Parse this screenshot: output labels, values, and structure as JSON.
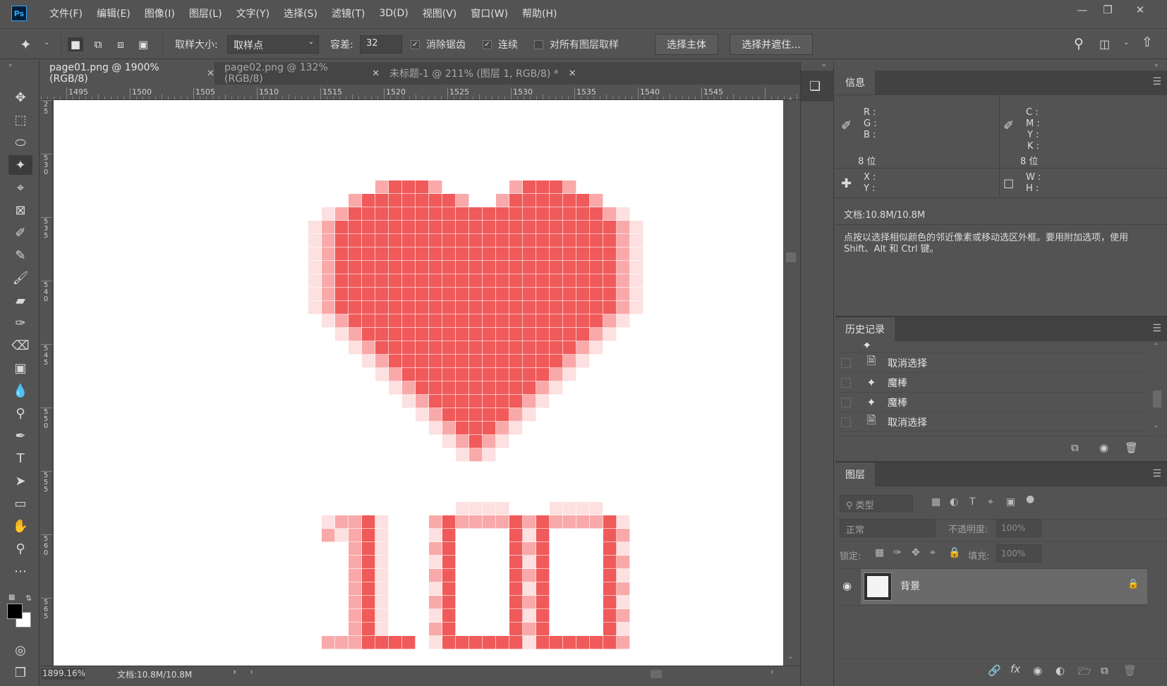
{
  "app": {
    "logo": "Ps"
  },
  "menu": [
    "文件(F)",
    "编辑(E)",
    "图像(I)",
    "图层(L)",
    "文字(Y)",
    "选择(S)",
    "滤镜(T)",
    "3D(D)",
    "视图(V)",
    "窗口(W)",
    "帮助(H)"
  ],
  "options": {
    "sample_size_label": "取样大小:",
    "sample_size_value": "取样点",
    "tolerance_label": "容差:",
    "tolerance_value": "32",
    "anti_alias_label": "消除锯齿",
    "anti_alias_checked": true,
    "contiguous_label": "连续",
    "contiguous_checked": true,
    "sample_all_label": "对所有图层取样",
    "sample_all_checked": false,
    "select_subject_label": "选择主体",
    "select_mask_label": "选择并遮住..."
  },
  "tabs": [
    {
      "label": "page01.png @ 1900%(RGB/8)",
      "active": true
    },
    {
      "label": "page02.png @ 132%(RGB/8)",
      "active": false
    },
    {
      "label": "未标题-1 @ 211% (图层 1, RGB/8) *",
      "active": false
    }
  ],
  "ruler": {
    "top_labels": [
      "1495",
      "1500",
      "1505",
      "1510",
      "1515",
      "1520",
      "1525",
      "1530",
      "1535",
      "1540",
      "1545"
    ],
    "left_labels": [
      "25",
      "530",
      "535",
      "540",
      "545",
      "550",
      "555",
      "560",
      "565"
    ]
  },
  "status": {
    "zoom": "1899.16%",
    "doc": "文档:10.8M/10.8M"
  },
  "info_panel": {
    "title": "信息",
    "rgb_labels": [
      "R :",
      "G :",
      "B :"
    ],
    "cmyk_labels": [
      "C :",
      "M :",
      "Y :",
      "K :"
    ],
    "bits_left": "8 位",
    "bits_right": "8 位",
    "xy_labels": [
      "X :",
      "Y :"
    ],
    "wh_labels": [
      "W :",
      "H :"
    ],
    "doc": "文档:10.8M/10.8M",
    "hint": "点按以选择相似颜色的邻近像素或移动选区外框。要用附加选项，使用 Shift、Alt 和 Ctrl 键。"
  },
  "history_panel": {
    "title": "历史记录",
    "items": [
      {
        "icon": "doc-icon",
        "label": "取消选择"
      },
      {
        "icon": "magic-wand-icon",
        "label": "魔棒"
      },
      {
        "icon": "magic-wand-icon",
        "label": "魔棒"
      },
      {
        "icon": "doc-icon",
        "label": "取消选择"
      }
    ]
  },
  "layers_panel": {
    "title": "图层",
    "filter_placeholder": "类型",
    "blend_mode": "正常",
    "opacity_label": "不透明度:",
    "opacity_value": "100%",
    "lock_label": "锁定:",
    "fill_label": "填充:",
    "fill_value": "100%",
    "layers": [
      {
        "name": "背景",
        "visible": true,
        "locked": true
      }
    ]
  },
  "colors": {
    "heart": "#f05a5a",
    "heart_light": "#f9a9a9",
    "heart_pale": "#fde0e0",
    "bg": "#535353"
  }
}
